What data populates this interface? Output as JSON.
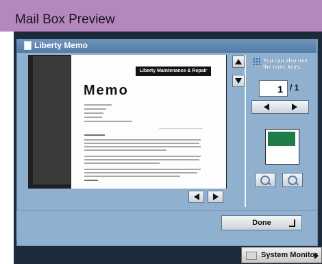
{
  "header": {
    "title": "Mail Box Preview"
  },
  "window": {
    "title": "Liberty Memo"
  },
  "document": {
    "company_banner": "Liberty Maintenance & Repair",
    "heading": "Memo"
  },
  "side": {
    "hint_line1": "You can also use",
    "hint_line2": "the num. keys.",
    "current_page": "1",
    "total_pages": "/ 1"
  },
  "footer": {
    "done_label": "Done",
    "system_monitor_label": "System Monitor"
  },
  "colors": {
    "header": "#b487be",
    "panel": "#8fb0cf",
    "thumbnail_fill": "#1f7d48"
  }
}
